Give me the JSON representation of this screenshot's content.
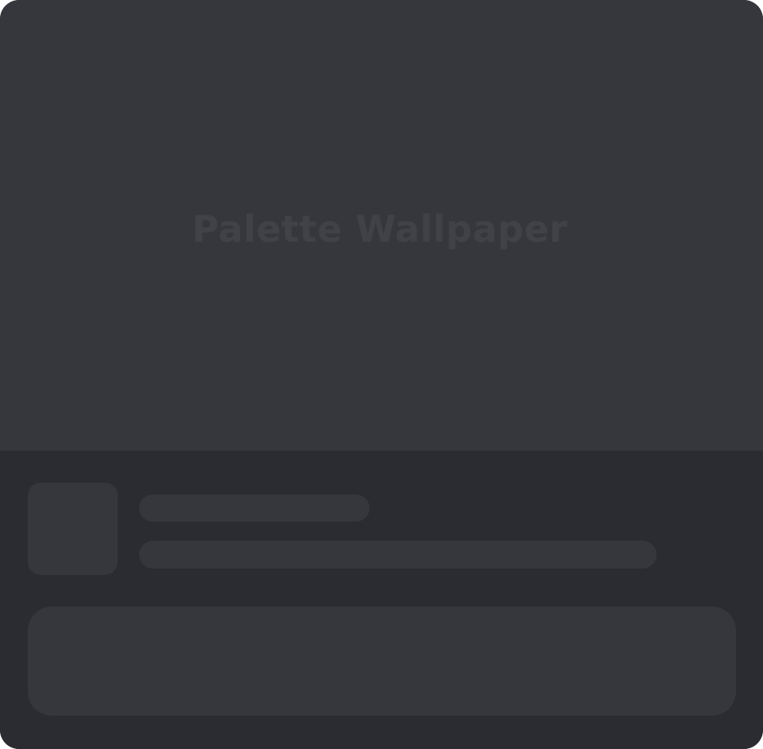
{
  "hero": {
    "title": "Palette Wallpaper"
  },
  "colors": {
    "hero_background": "#36373c",
    "panel_background": "#2b2c31",
    "skeleton": "#36373c",
    "title_text": "#414247"
  }
}
